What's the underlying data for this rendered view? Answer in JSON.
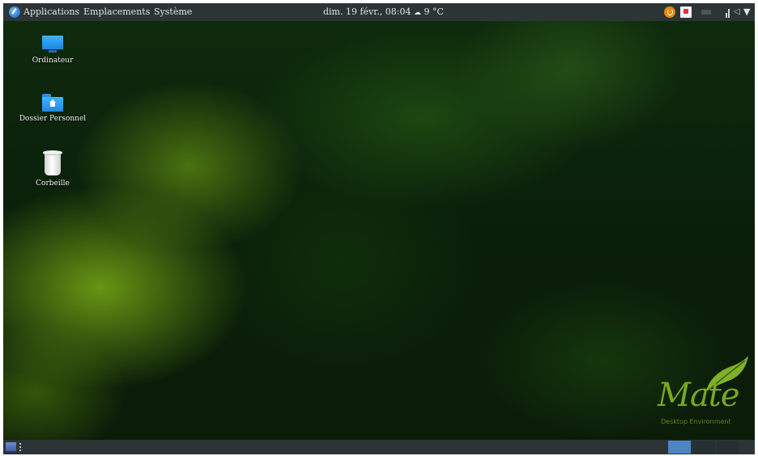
{
  "top_panel": {
    "menus": [
      "Applications",
      "Emplacements",
      "Système"
    ],
    "clock": "dim. 19 févr., 08:04",
    "weather_icon": "weather-cloud-icon",
    "temperature": "9 °C",
    "tray_icons": [
      "update-notifier-icon",
      "mail-icon",
      "keyboard-layout-icon",
      "network-bars-icon",
      "volume-icon",
      "wifi-icon"
    ]
  },
  "desktop": {
    "icons": [
      {
        "label": "Ordinateur",
        "icon": "computer-icon"
      },
      {
        "label": "Dossier Personnel",
        "icon": "home-folder-icon"
      },
      {
        "label": "Corbeille",
        "icon": "trash-icon"
      }
    ],
    "watermark": {
      "brand": "Mate",
      "subtitle": "Desktop Environment"
    }
  },
  "bottom_panel": {
    "show_desktop_icon": "show-desktop-icon",
    "workspaces": 3,
    "active_workspace": 1
  },
  "colors": {
    "panel": "#2d3436",
    "accent": "#4f84c4",
    "mate_green": "#79a81f"
  }
}
